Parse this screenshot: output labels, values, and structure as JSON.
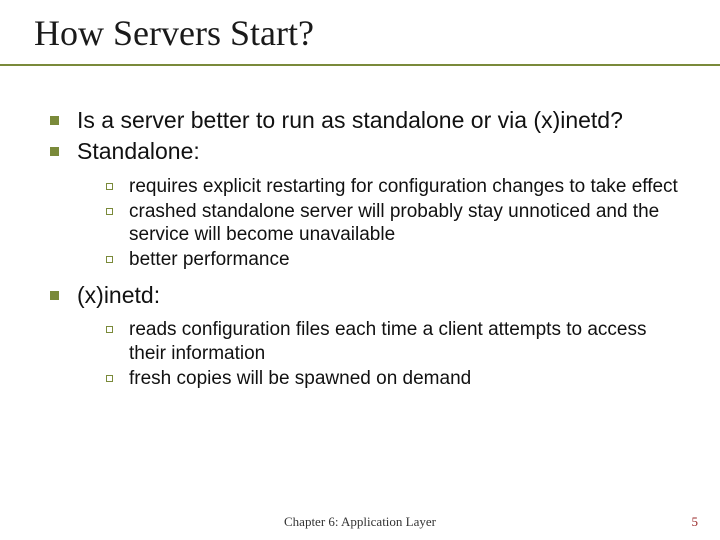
{
  "title": "How Servers Start?",
  "bullets": {
    "b1": "Is a server better to run as standalone or via (x)inetd?",
    "b2": "Standalone:",
    "b2sub": {
      "s1": "requires explicit restarting for configuration changes to take effect",
      "s2": "crashed standalone server will probably stay unnoticed and the service will become unavailable",
      "s3": "better performance"
    },
    "b3": "(x)inetd:",
    "b3sub": {
      "s1": "reads configuration files each time a client attempts to access their information",
      "s2": "fresh copies will be spawned on demand"
    }
  },
  "footer": "Chapter 6: Application Layer",
  "page": "5"
}
